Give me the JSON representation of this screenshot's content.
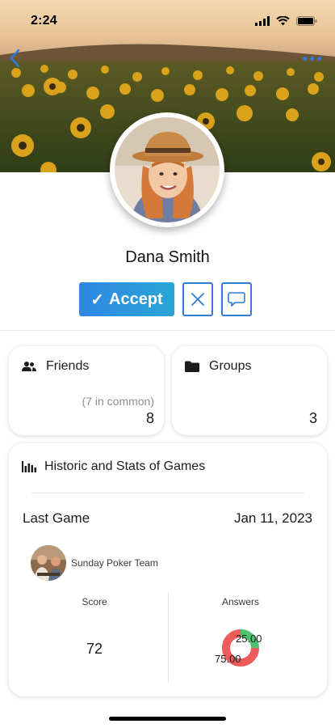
{
  "status_bar": {
    "time": "2:24"
  },
  "profile": {
    "name": "Dana Smith"
  },
  "actions": {
    "accept_label": "Accept",
    "accept_check": "✓"
  },
  "friends": {
    "title": "Friends",
    "common": "(7 in common)",
    "count": "8"
  },
  "groups": {
    "title": "Groups",
    "count": "3"
  },
  "stats": {
    "title": "Historic and Stats of Games",
    "last_game_label": "Last Game",
    "last_game_date": "Jan 11, 2023",
    "team_name": "Sunday Poker Team",
    "score_label": "Score",
    "score_value": "72",
    "answers_label": "Answers",
    "answers": [
      {
        "value": 25,
        "display": "25.00",
        "color": "#4fc16f"
      },
      {
        "value": 75,
        "display": "75.00",
        "color": "#ef5a5a"
      }
    ]
  },
  "colors": {
    "accent": "#2f7bd8",
    "accept_start": "#2f86e4",
    "accept_end": "#2aa6d6"
  },
  "icons": [
    "chevron-left-icon",
    "more-dots-icon",
    "close-icon",
    "chat-bubble-icon",
    "people-icon",
    "folder-icon",
    "bar-chart-icon"
  ]
}
